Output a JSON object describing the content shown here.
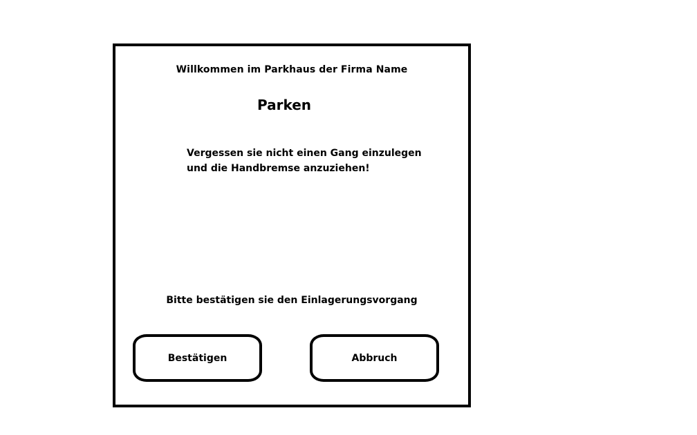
{
  "screen": {
    "welcome_text": "Willkommen im Parkhaus der Firma  Name",
    "title": "Parken",
    "notice_line1": "Vergessen sie nicht einen Gang einzulegen",
    "notice_line2": "und die Handbremse anzuziehen!",
    "confirm_prompt": "Bitte bestätigen sie den Einlagerungsvorgang",
    "buttons": {
      "confirm_label": "Bestätigen",
      "cancel_label": "Abbruch"
    }
  }
}
